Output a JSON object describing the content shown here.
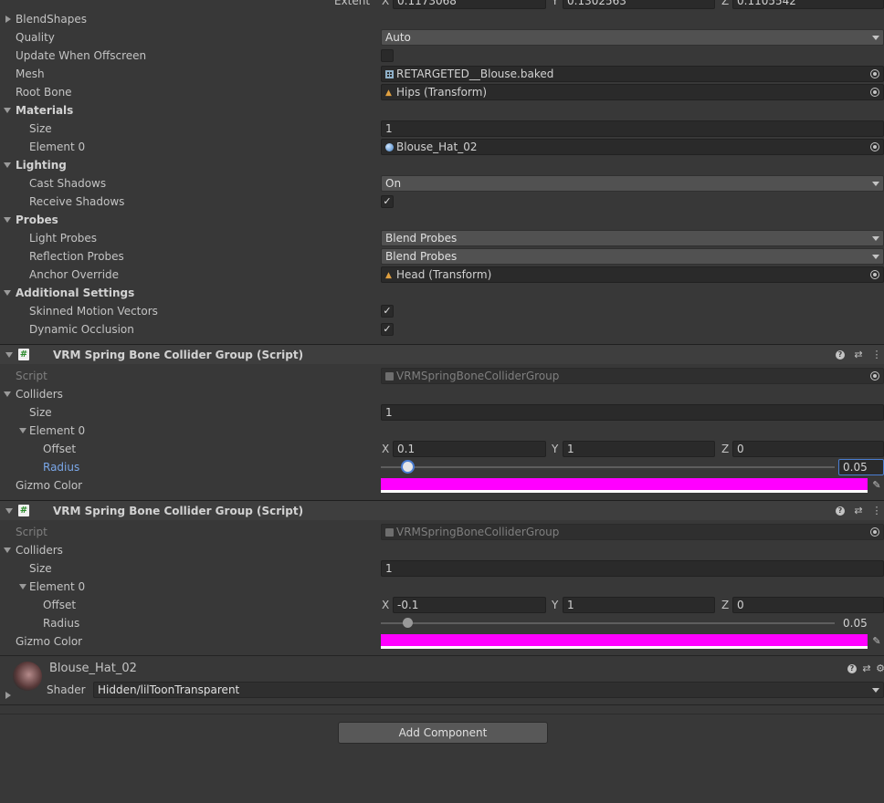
{
  "top": {
    "extent_label": "Extent",
    "extent_x": "0.1173068",
    "extent_y": "0.1302563",
    "extent_z": "0.1105542"
  },
  "axes": {
    "x": "X",
    "y": "Y",
    "z": "Z"
  },
  "renderer": {
    "blendshapes_label": "BlendShapes",
    "quality_label": "Quality",
    "quality_value": "Auto",
    "update_offscreen_label": "Update When Offscreen",
    "mesh_label": "Mesh",
    "mesh_value": "RETARGETED__Blouse.baked",
    "root_bone_label": "Root Bone",
    "root_bone_value": "Hips (Transform)",
    "materials_label": "Materials",
    "materials_size_label": "Size",
    "materials_size_value": "1",
    "element0_label": "Element 0",
    "element0_value": "Blouse_Hat_02",
    "lighting_label": "Lighting",
    "cast_shadows_label": "Cast Shadows",
    "cast_shadows_value": "On",
    "receive_shadows_label": "Receive Shadows",
    "probes_label": "Probes",
    "light_probes_label": "Light Probes",
    "light_probes_value": "Blend Probes",
    "reflection_probes_label": "Reflection Probes",
    "reflection_probes_value": "Blend Probes",
    "anchor_override_label": "Anchor Override",
    "anchor_override_value": "Head (Transform)",
    "additional_label": "Additional Settings",
    "skinned_motion_label": "Skinned Motion Vectors",
    "dynamic_occlusion_label": "Dynamic Occlusion",
    "check_mark": "✓"
  },
  "collider1": {
    "title": "VRM Spring Bone Collider Group (Script)",
    "script_label": "Script",
    "script_value": "VRMSpringBoneColliderGroup",
    "colliders_label": "Colliders",
    "size_label": "Size",
    "size_value": "1",
    "element_label": "Element 0",
    "offset_label": "Offset",
    "offset_x": "0.1",
    "offset_y": "1",
    "offset_z": "0",
    "radius_label": "Radius",
    "radius_value": "0.05",
    "radius_fraction": 0.06,
    "gizmo_label": "Gizmo Color",
    "gizmo_color": "#ff00ff"
  },
  "collider2": {
    "title": "VRM Spring Bone Collider Group (Script)",
    "script_label": "Script",
    "script_value": "VRMSpringBoneColliderGroup",
    "colliders_label": "Colliders",
    "size_label": "Size",
    "size_value": "1",
    "element_label": "Element 0",
    "offset_label": "Offset",
    "offset_x": "-0.1",
    "offset_y": "1",
    "offset_z": "0",
    "radius_label": "Radius",
    "radius_value": "0.05",
    "radius_fraction": 0.06,
    "gizmo_label": "Gizmo Color",
    "gizmo_color": "#ff00ff"
  },
  "material": {
    "name": "Blouse_Hat_02",
    "shader_label": "Shader",
    "shader_value": "Hidden/lilToonTransparent"
  },
  "icons": {
    "script": "#",
    "help": "?",
    "settings": "⇄",
    "more": "⋮",
    "eyedropper": "✎",
    "gear": "⚙"
  },
  "add_component_label": "Add Component"
}
